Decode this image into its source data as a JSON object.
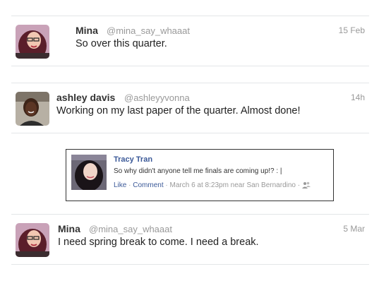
{
  "tweets": [
    {
      "name": "Mina",
      "handle": "@mina_say_whaaat",
      "time": "15 Feb",
      "text": "So over this quarter."
    },
    {
      "name": "ashley davis",
      "handle": "@ashleyyvonna",
      "time": "14h",
      "text": "Working on my last paper of the quarter. Almost done!"
    },
    {
      "name": "Mina",
      "handle": "@mina_say_whaaat",
      "time": "5 Mar",
      "text": "I need spring break to come. I need a break."
    }
  ],
  "facebook_post": {
    "name": "Tracy Tran",
    "text": "So why didn't anyone tell me finals are coming up!? : |",
    "like_label": "Like",
    "dot1": "·",
    "comment_label": "Comment",
    "dot2": "·",
    "meta": "March 6 at 8:23pm near San Bernardino",
    "dot3": "·"
  },
  "colors": {
    "facebook_blue": "#3b5998",
    "muted_gray": "#999999",
    "divider": "#e3e6e8"
  }
}
